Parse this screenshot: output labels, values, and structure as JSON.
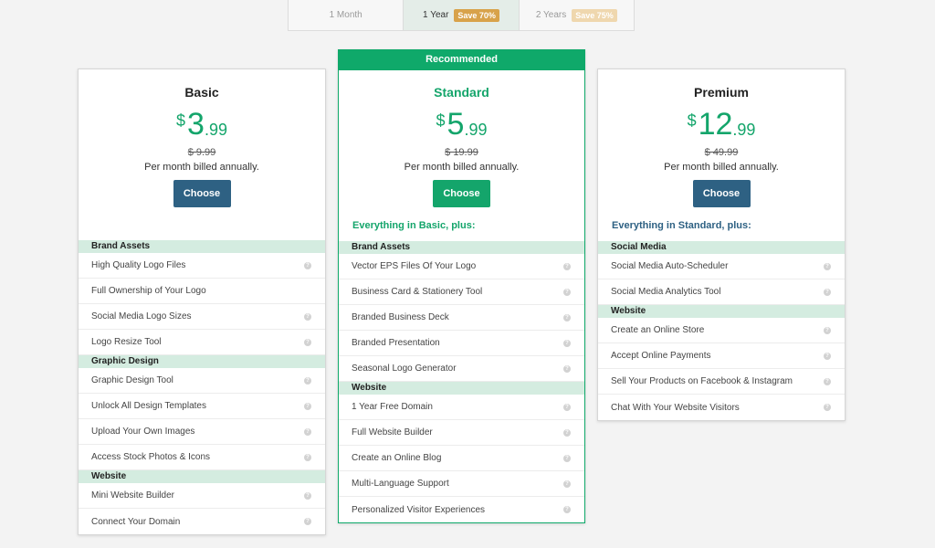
{
  "toggle": {
    "options": [
      {
        "label": "1 Month",
        "badge": ""
      },
      {
        "label": "1 Year",
        "badge": "Save 70%"
      },
      {
        "label": "2 Years",
        "badge": "Save 75%"
      }
    ],
    "active": "1 Year"
  },
  "plans": {
    "basic": {
      "name": "Basic",
      "currency": "$",
      "price_int": "3",
      "price_dec": ".99",
      "old_price": "$ 9.99",
      "billing": "Per month billed annually.",
      "choose": "Choose",
      "sections": [
        {
          "title": "Brand Assets",
          "items": [
            "High Quality Logo Files",
            "Full Ownership of Your Logo",
            "Social Media Logo Sizes",
            "Logo Resize Tool"
          ]
        },
        {
          "title": "Graphic Design",
          "items": [
            "Graphic Design Tool",
            "Unlock All Design Templates",
            "Upload Your Own Images",
            "Access Stock Photos & Icons"
          ]
        },
        {
          "title": "Website",
          "items": [
            "Mini Website Builder",
            "Connect Your Domain"
          ]
        }
      ]
    },
    "standard": {
      "banner": "Recommended",
      "name": "Standard",
      "currency": "$",
      "price_int": "5",
      "price_dec": ".99",
      "old_price": "$ 19.99",
      "billing": "Per month billed annually.",
      "choose": "Choose",
      "plus": "Everything in Basic, plus:",
      "sections": [
        {
          "title": "Brand Assets",
          "items": [
            "Vector EPS Files Of Your Logo",
            "Business Card & Stationery Tool",
            "Branded Business Deck",
            "Branded Presentation",
            "Seasonal Logo Generator"
          ]
        },
        {
          "title": "Website",
          "items": [
            "1 Year Free Domain",
            "Full Website Builder",
            "Create an Online Blog",
            "Multi-Language Support",
            "Personalized Visitor Experiences"
          ]
        }
      ]
    },
    "premium": {
      "name": "Premium",
      "currency": "$",
      "price_int": "12",
      "price_dec": ".99",
      "old_price": "$ 49.99",
      "billing": "Per month billed annually.",
      "choose": "Choose",
      "plus": "Everything in Standard, plus:",
      "sections": [
        {
          "title": "Social Media",
          "items": [
            "Social Media Auto-Scheduler",
            "Social Media Analytics Tool"
          ]
        },
        {
          "title": "Website",
          "items": [
            "Create an Online Store",
            "Accept Online Payments",
            "Sell Your Products on Facebook & Instagram",
            "Chat With Your Website Visitors"
          ]
        }
      ]
    }
  },
  "icons": {
    "tooltip": "question-icon"
  },
  "colors": {
    "green": "#14a56b",
    "blue": "#2e6183",
    "section_bg": "#d4ece0",
    "badge": "#d8a24a"
  }
}
